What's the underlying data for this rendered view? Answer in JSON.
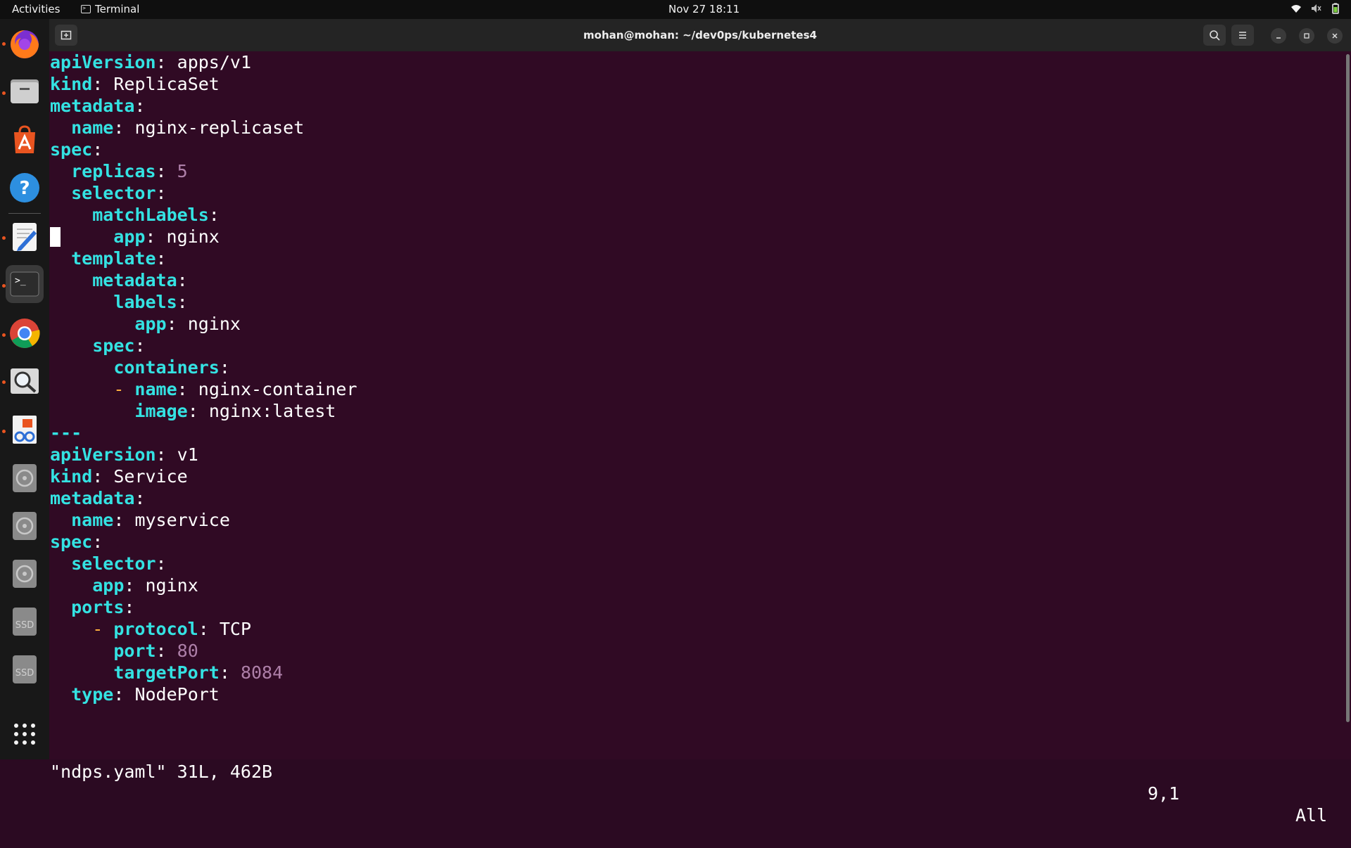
{
  "topbar": {
    "activities": "Activities",
    "app_name": "Terminal",
    "datetime": "Nov 27  18:11",
    "icons": [
      "wifi-icon",
      "volume-muted-icon",
      "battery-icon"
    ]
  },
  "dock": {
    "items": [
      {
        "name": "firefox",
        "icon": "firefox-icon",
        "running": true
      },
      {
        "name": "files",
        "icon": "files-icon",
        "running": true
      },
      {
        "name": "app-center",
        "icon": "app-center-icon",
        "running": false
      },
      {
        "name": "help",
        "icon": "help-icon",
        "running": false
      },
      {
        "name": "text-editor",
        "icon": "text-editor-icon",
        "running": true
      },
      {
        "name": "terminal",
        "icon": "terminal-icon",
        "running": true,
        "active": true
      },
      {
        "name": "chrome",
        "icon": "chrome-icon",
        "running": true
      },
      {
        "name": "image-viewer",
        "icon": "magnifier-icon",
        "running": true
      },
      {
        "name": "document-viewer",
        "icon": "reader-icon",
        "running": true
      },
      {
        "name": "disc-1",
        "icon": "disc-icon",
        "running": false
      },
      {
        "name": "disc-2",
        "icon": "disc-icon",
        "running": false
      },
      {
        "name": "disc-3",
        "icon": "disc-icon",
        "running": false
      },
      {
        "name": "ssd-1",
        "icon": "ssd-icon",
        "label": "SSD",
        "running": false
      },
      {
        "name": "ssd-2",
        "icon": "ssd-icon",
        "label": "SSD",
        "running": false
      },
      {
        "name": "show-apps",
        "icon": "app-grid-icon",
        "running": false
      }
    ]
  },
  "window": {
    "title": "mohan@mohan: ~/dev0ps/kubernetes4"
  },
  "editor": {
    "lines": [
      {
        "indent": "",
        "key": "apiVersion",
        "value": "apps/v1",
        "vtype": "str"
      },
      {
        "indent": "",
        "key": "kind",
        "value": "ReplicaSet",
        "vtype": "str"
      },
      {
        "indent": "",
        "key": "metadata",
        "value": "",
        "vtype": "str"
      },
      {
        "indent": "  ",
        "key": "name",
        "value": "nginx-replicaset",
        "vtype": "str"
      },
      {
        "indent": "",
        "key": "spec",
        "value": "",
        "vtype": "str"
      },
      {
        "indent": "  ",
        "key": "replicas",
        "value": "5",
        "vtype": "num"
      },
      {
        "indent": "  ",
        "key": "selector",
        "value": "",
        "vtype": "str"
      },
      {
        "indent": "    ",
        "key": "matchLabels",
        "value": "",
        "vtype": "str"
      },
      {
        "indent": "      ",
        "key": "app",
        "value": "nginx",
        "vtype": "str",
        "cursor": true
      },
      {
        "indent": "  ",
        "key": "template",
        "value": "",
        "vtype": "str"
      },
      {
        "indent": "    ",
        "key": "metadata",
        "value": "",
        "vtype": "str"
      },
      {
        "indent": "      ",
        "key": "labels",
        "value": "",
        "vtype": "str"
      },
      {
        "indent": "        ",
        "key": "app",
        "value": "nginx",
        "vtype": "str"
      },
      {
        "indent": "    ",
        "key": "spec",
        "value": "",
        "vtype": "str"
      },
      {
        "indent": "      ",
        "key": "containers",
        "value": "",
        "vtype": "str"
      },
      {
        "indent": "      ",
        "dash": "- ",
        "key": "name",
        "value": "nginx-container",
        "vtype": "str"
      },
      {
        "indent": "        ",
        "key": "image",
        "value": "nginx:latest",
        "vtype": "str"
      },
      {
        "indent": "",
        "raw": "---"
      },
      {
        "indent": "",
        "key": "apiVersion",
        "value": "v1",
        "vtype": "str"
      },
      {
        "indent": "",
        "key": "kind",
        "value": "Service",
        "vtype": "str"
      },
      {
        "indent": "",
        "key": "metadata",
        "value": "",
        "vtype": "str"
      },
      {
        "indent": "  ",
        "key": "name",
        "value": "myservice",
        "vtype": "str"
      },
      {
        "indent": "",
        "key": "spec",
        "value": "",
        "vtype": "str"
      },
      {
        "indent": "  ",
        "key": "selector",
        "value": "",
        "vtype": "str"
      },
      {
        "indent": "    ",
        "key": "app",
        "value": "nginx",
        "vtype": "str"
      },
      {
        "indent": "  ",
        "key": "ports",
        "value": "",
        "vtype": "str"
      },
      {
        "indent": "    ",
        "dash": "- ",
        "key": "protocol",
        "value": "TCP",
        "vtype": "str"
      },
      {
        "indent": "      ",
        "key": "port",
        "value": "80",
        "vtype": "num"
      },
      {
        "indent": "      ",
        "key": "targetPort",
        "value": "8084",
        "vtype": "num"
      },
      {
        "indent": "  ",
        "key": "type",
        "value": "NodePort",
        "vtype": "str"
      }
    ],
    "status": {
      "file_info": "\"ndps.yaml\" 31L, 462B",
      "position": "9,1",
      "scroll": "All"
    }
  },
  "colors": {
    "background": "#300a24",
    "key": "#34e2e2",
    "number": "#ad7fa8",
    "dash": "#fcaf3e",
    "text": "#ffffff"
  }
}
